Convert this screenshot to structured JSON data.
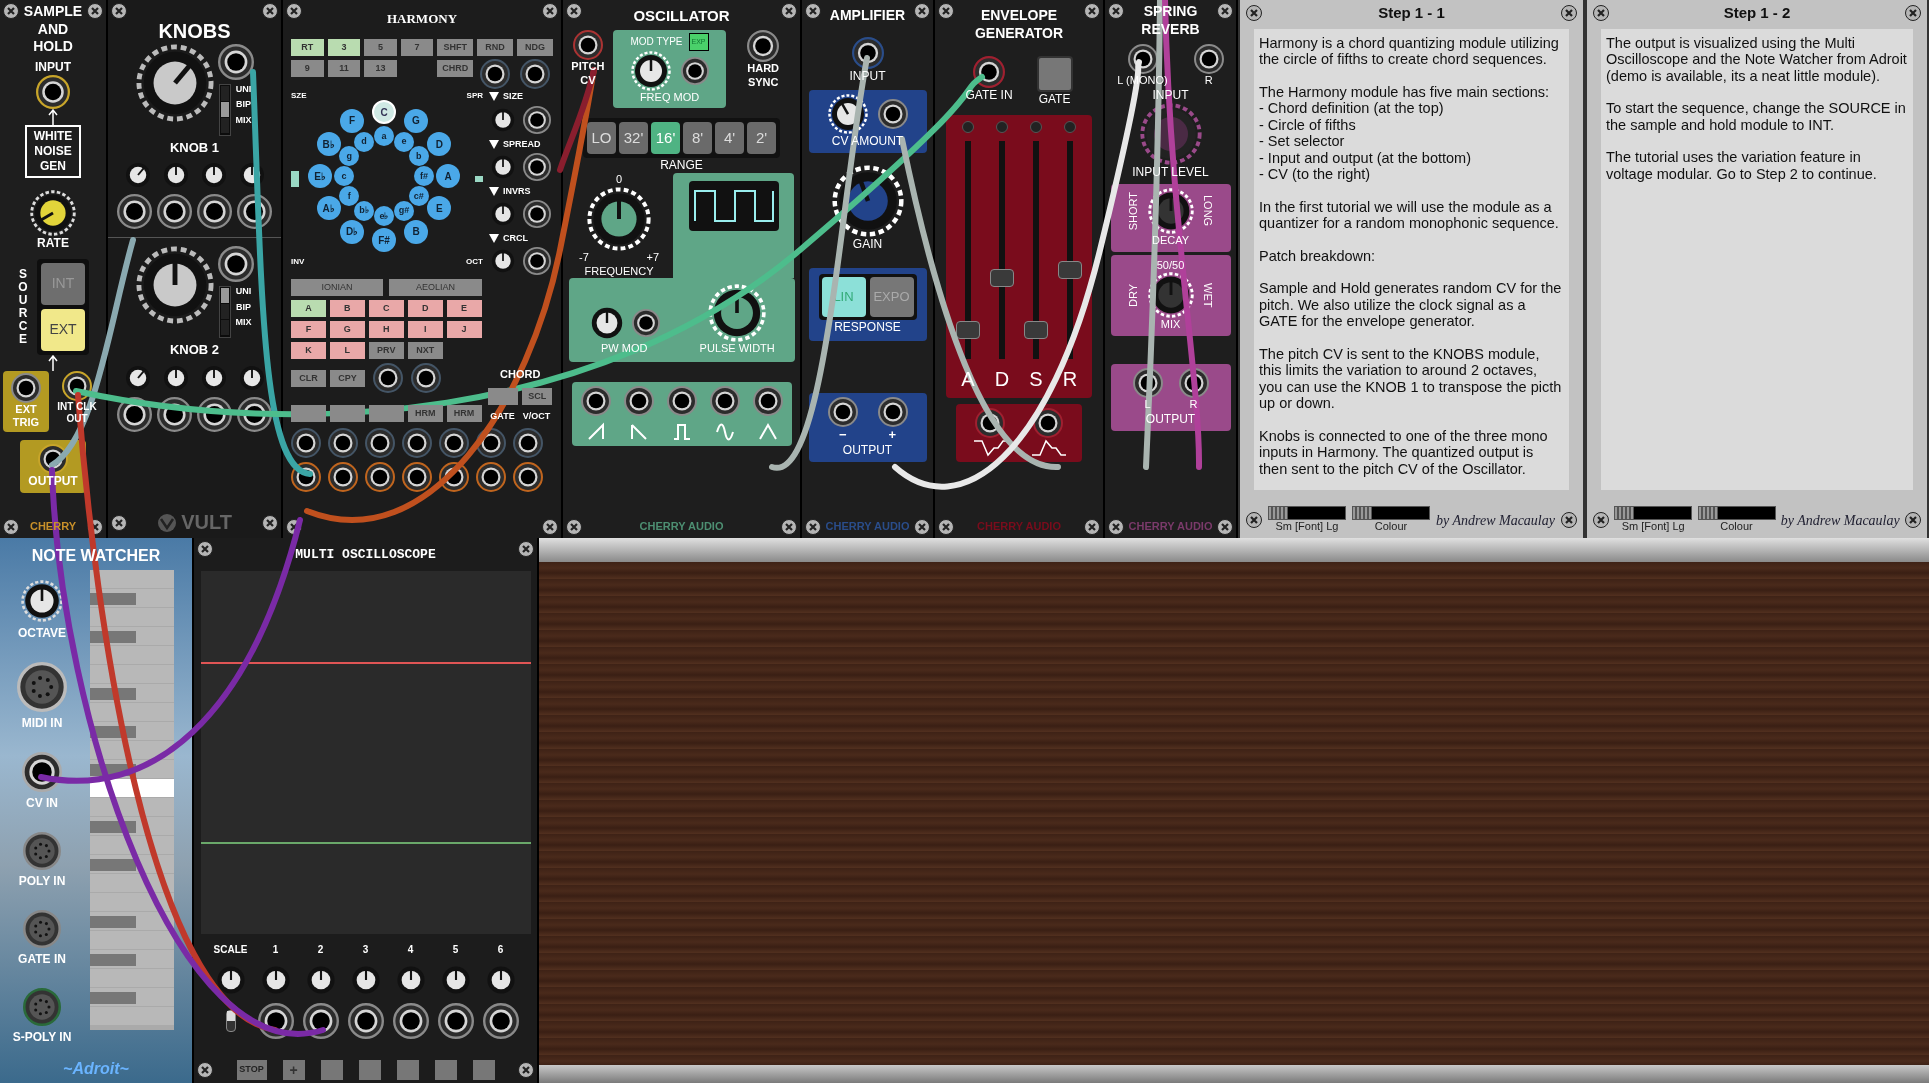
{
  "sample_hold": {
    "title": "SAMPLE AND HOLD",
    "input": "INPUT",
    "noise": "WHITE NOISE GEN",
    "rate": "RATE",
    "source": "SOURCE",
    "modes": [
      {
        "label": "INT",
        "selected": false
      },
      {
        "label": "EXT",
        "selected": true
      }
    ],
    "ext_trig": "EXT TRIG",
    "clock_out": "INT CLK OUT",
    "output": "OUTPUT",
    "brand": "CHERRY"
  },
  "knobs": {
    "title": "KNOBS",
    "sections": [
      {
        "label": "KNOB 1",
        "modes": [
          {
            "label": "UNI",
            "selected": false
          },
          {
            "label": "BIP",
            "selected": true
          },
          {
            "label": "MIX",
            "selected": false
          }
        ]
      },
      {
        "label": "KNOB 2",
        "modes": [
          {
            "label": "UNI",
            "selected": true
          },
          {
            "label": "BIP",
            "selected": false
          },
          {
            "label": "MIX",
            "selected": false
          }
        ]
      }
    ],
    "brand": "VULT"
  },
  "harmony": {
    "title": "HARMONY",
    "intervals": [
      {
        "label": "RT",
        "on": true
      },
      {
        "label": "3",
        "on": true
      },
      {
        "label": "5",
        "on": false
      },
      {
        "label": "7",
        "on": false
      },
      {
        "label": "9",
        "on": false
      },
      {
        "label": "11",
        "on": false
      },
      {
        "label": "13",
        "on": false
      }
    ],
    "shift": "SHFT",
    "chord_button": "CHRD",
    "random": "RND",
    "nudge": "NDG",
    "size_short": "SZE",
    "spread_short": "SPR",
    "inversion_short": "INV",
    "octave_short": "OCT",
    "majors": [
      {
        "label": "C",
        "selected": true
      },
      {
        "label": "G",
        "selected": false
      },
      {
        "label": "D",
        "selected": false
      },
      {
        "label": "A",
        "selected": false
      },
      {
        "label": "E",
        "selected": false
      },
      {
        "label": "B",
        "selected": false
      },
      {
        "label": "F#",
        "selected": false
      },
      {
        "label": "D♭",
        "selected": false
      },
      {
        "label": "A♭",
        "selected": false
      },
      {
        "label": "E♭",
        "selected": false
      },
      {
        "label": "B♭",
        "selected": false
      },
      {
        "label": "F",
        "selected": false
      }
    ],
    "minors": [
      "a",
      "e",
      "b",
      "f#",
      "c#",
      "g#",
      "e♭",
      "b♭",
      "f",
      "c",
      "g",
      "d"
    ],
    "cv_controls": [
      "SIZE",
      "SPREAD",
      "INVRS",
      "CRCL"
    ],
    "scales": [
      "IONIAN",
      "AEOLIAN"
    ],
    "sets": [
      {
        "label": "A",
        "selected": true
      },
      {
        "label": "B",
        "selected": false
      },
      {
        "label": "C",
        "selected": false
      },
      {
        "label": "D",
        "selected": false
      },
      {
        "label": "E",
        "selected": false
      },
      {
        "label": "F",
        "selected": false
      },
      {
        "label": "G",
        "selected": false
      },
      {
        "label": "H",
        "selected": false
      },
      {
        "label": "I",
        "selected": false
      },
      {
        "label": "J",
        "selected": false
      },
      {
        "label": "K",
        "selected": false
      },
      {
        "label": "L",
        "selected": false
      }
    ],
    "nav": [
      "PRV",
      "NXT"
    ],
    "edit": [
      "CLR",
      "CPY"
    ],
    "chord": "CHORD",
    "mode_buttons": [
      "HRM",
      "HRM"
    ],
    "scale_button": "SCL",
    "gate": "GATE",
    "voct": "V/OCT"
  },
  "oscillator": {
    "title": "OSCILLATOR",
    "pitch_cv": "PITCH CV",
    "mod_type": "MOD TYPE",
    "exp": {
      "label": "EXP",
      "on": true
    },
    "freq_mod": "FREQ MOD",
    "hard_sync": "HARD SYNC",
    "ranges": [
      {
        "label": "LO",
        "selected": false
      },
      {
        "label": "32'",
        "selected": false
      },
      {
        "label": "16'",
        "selected": true
      },
      {
        "label": "8'",
        "selected": false
      },
      {
        "label": "4'",
        "selected": false
      },
      {
        "label": "2'",
        "selected": false
      }
    ],
    "range": "RANGE",
    "freq_center": "0",
    "freq_min": "-7",
    "freq_max": "+7",
    "frequency": "FREQUENCY",
    "pw_mod": "PW MOD",
    "pulse_width": "PULSE WIDTH",
    "brand": "CHERRY AUDIO"
  },
  "amplifier": {
    "title": "AMPLIFIER",
    "input": "INPUT",
    "cv_amount": "CV AMOUNT",
    "gain": "GAIN",
    "responses": [
      {
        "label": "LIN",
        "selected": true
      },
      {
        "label": "EXPO",
        "selected": false
      }
    ],
    "response": "RESPONSE",
    "minus": "−",
    "plus": "+",
    "output": "OUTPUT",
    "brand": "CHERRY AUDIO"
  },
  "envelope": {
    "title": "ENVELOPE GENERATOR",
    "gate_in": "GATE IN",
    "gate": "GATE",
    "sliders": [
      {
        "label": "A",
        "level": 0.1
      },
      {
        "label": "D",
        "level": 0.36
      },
      {
        "label": "S",
        "level": 0.1
      },
      {
        "label": "R",
        "level": 0.4
      }
    ],
    "brand": "CHERRY AUDIO"
  },
  "reverb": {
    "title": "SPRING REVERB",
    "inputs": [
      "L (MONO)",
      "R"
    ],
    "input": "INPUT",
    "input_level": "INPUT LEVEL",
    "short": "SHORT",
    "long": "LONG",
    "decay": "DECAY",
    "mix_center": "50/50",
    "dry": "DRY",
    "wet": "WET",
    "mix": "MIX",
    "outputs": [
      "L",
      "R"
    ],
    "output": "OUTPUT",
    "brand": "CHERRY AUDIO"
  },
  "notes": [
    {
      "title": "Step 1 - 1",
      "blocks": [
        [
          "Harmony is a chord quantizing module utilizing the circle of fifths to create chord sequences."
        ],
        [
          "The Harmony module has five main sections:",
          "- Chord definition (at the top)",
          "- Circle of fifths",
          "- Set selector",
          "- Input and output (at the bottom)",
          "- CV (to the right)"
        ],
        [
          "In the first tutorial we will use the module as a quantizer for a random monophonic sequence."
        ],
        [
          "Patch breakdown:"
        ],
        [
          "Sample and Hold generates random CV for the pitch. We also utilize the clock signal as a GATE for the envelope generator."
        ],
        [
          "The pitch CV is sent to the KNOBS module, this limits the variation to around 2 octaves, you can use the KNOB 1 to transpose the picth up or down."
        ],
        [
          "Knobs is connected to one of the three mono inputs in Harmony. The quantized output is then sent to the pitch CV of the Oscillator."
        ]
      ],
      "font_slider": {
        "label": "Sm [Font] Lg",
        "level": 0.25
      },
      "colour_slider": {
        "label": "Colour",
        "level": 0.25
      },
      "author": "by Andrew Macaulay"
    },
    {
      "title": "Step 1 - 2",
      "blocks": [
        [
          "The output is visualized using the Multi Oscilloscope and the Note Watcher from Adroit (demo is available, its a neat little module)."
        ],
        [
          "To start the sequence, change the SOURCE in the sample and hold module to INT."
        ],
        [
          "The tutorial uses the variation feature in voltage modular. Go to Step 2 to continue."
        ]
      ],
      "font_slider": {
        "label": "Sm [Font] Lg",
        "level": 0.25
      },
      "colour_slider": {
        "label": "Colour",
        "level": 0.25
      },
      "author": "by Andrew Macaulay"
    }
  ],
  "note_watcher": {
    "title": "NOTE WATCHER",
    "inputs": [
      {
        "label": "OCTAVE",
        "kind": "knob"
      },
      {
        "label": "MIDI IN",
        "kind": "midi"
      },
      {
        "label": "CV IN",
        "kind": "jack"
      },
      {
        "label": "POLY IN",
        "kind": "din"
      },
      {
        "label": "GATE IN",
        "kind": "din"
      },
      {
        "label": "S-POLY IN",
        "kind": "din"
      }
    ],
    "brand": "~Adroit~"
  },
  "scope": {
    "title": "MULTI OSCILLOSCOPE",
    "mode_switch": {
      "on": true
    },
    "scale": "SCALE",
    "channels": [
      "1",
      "2",
      "3",
      "4",
      "5",
      "6"
    ],
    "stop": "STOP",
    "add": "+"
  }
}
